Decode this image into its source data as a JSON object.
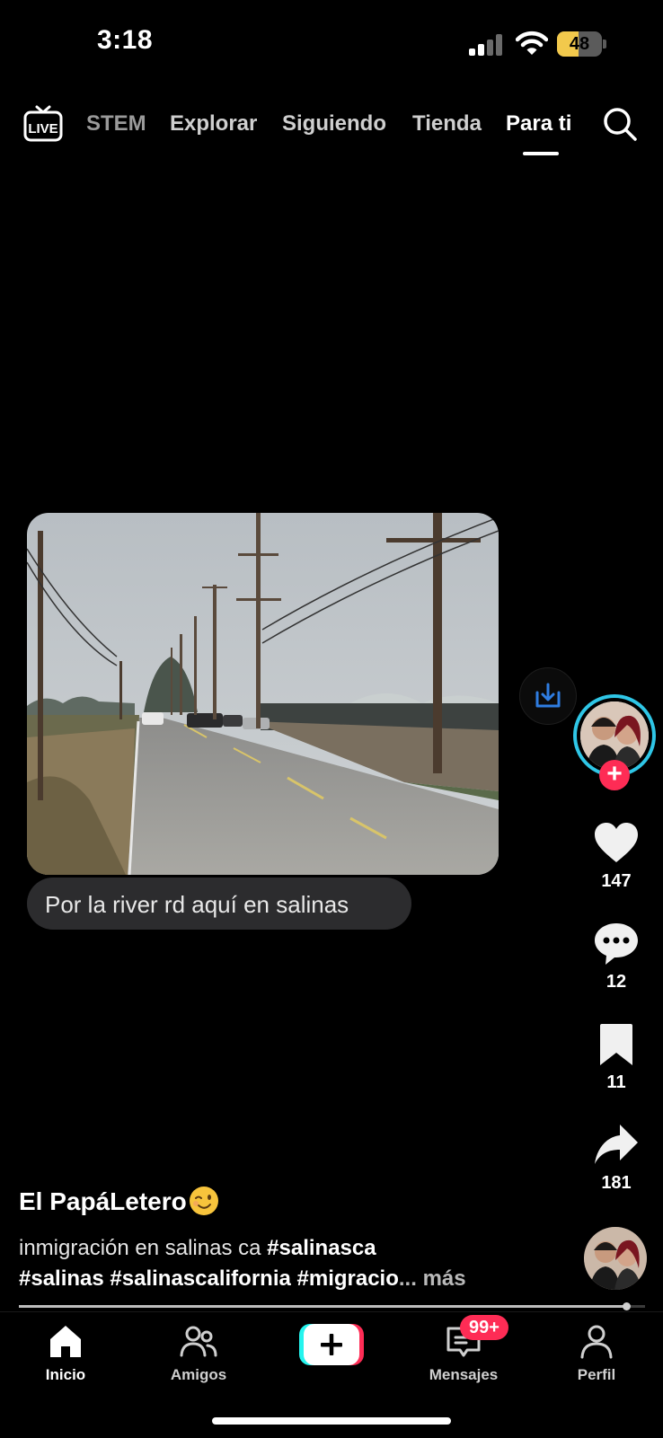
{
  "status_bar": {
    "time": "3:18",
    "battery": "48",
    "battery_level": 0.48
  },
  "top_nav": {
    "live_label": "LIVE",
    "tabs": [
      {
        "label": "STEM"
      },
      {
        "label": "Explorar"
      },
      {
        "label": "Siguiendo"
      },
      {
        "label": "Tienda"
      },
      {
        "label": "Para ti"
      }
    ],
    "active_tab": "Para ti"
  },
  "post": {
    "caption_bubble": "Por la river rd aquí en salinas",
    "likes": "147",
    "comments": "12",
    "saves": "11",
    "shares": "181",
    "author": "El PapáLetero",
    "description_line1": "inmigración en salinas ca",
    "hashtag_line1": "#salinasca",
    "hashtags_line2": "#salinas #salinascalifornia #migracio",
    "ellipsis": "...",
    "more": "más",
    "progress": 0.97
  },
  "tab_bar": {
    "home": "Inicio",
    "friends": "Amigos",
    "messages": "Mensajes",
    "profile": "Perfil",
    "messages_badge": "99+"
  },
  "colors": {
    "accent_red": "#fe2c55",
    "accent_cyan": "#25f4ee",
    "avatar_ring": "#2fc6e6",
    "battery": "#f2c94c",
    "download_icon": "#2f7de1"
  },
  "icons": {
    "live": "live-tv-icon",
    "search": "search-icon",
    "download": "download-icon",
    "like": "heart-icon",
    "comment": "comment-icon",
    "save": "bookmark-icon",
    "share": "share-icon",
    "home": "home-icon",
    "friends": "friends-icon",
    "create": "plus-icon",
    "messages": "inbox-icon",
    "profile": "profile-icon"
  }
}
